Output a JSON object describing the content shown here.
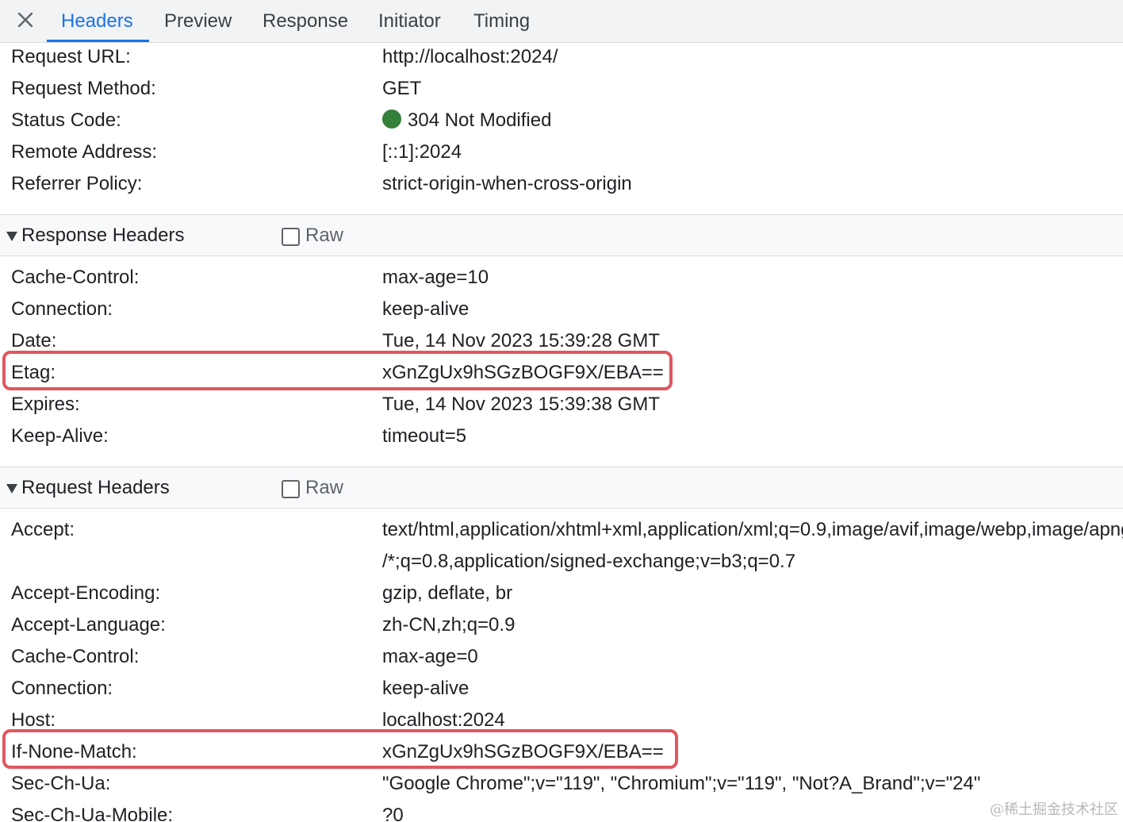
{
  "tabs": [
    {
      "label": "Headers",
      "active": true
    },
    {
      "label": "Preview"
    },
    {
      "label": "Response"
    },
    {
      "label": "Initiator"
    },
    {
      "label": "Timing"
    }
  ],
  "general": [
    {
      "key": "Request URL:",
      "value": "http://localhost:2024/"
    },
    {
      "key": "Request Method:",
      "value": "GET"
    },
    {
      "key": "Status Code:",
      "value": "304 Not Modified"
    },
    {
      "key": "Remote Address:",
      "value": "[::1]:2024"
    },
    {
      "key": "Referrer Policy:",
      "value": "strict-origin-when-cross-origin"
    }
  ],
  "response_headers": {
    "title": "Response Headers",
    "raw_label": "Raw",
    "rows": [
      {
        "key": "Cache-Control:",
        "value": "max-age=10"
      },
      {
        "key": "Connection:",
        "value": "keep-alive"
      },
      {
        "key": "Date:",
        "value": "Tue, 14 Nov 2023 15:39:28 GMT"
      },
      {
        "key": "Etag:",
        "value": "xGnZgUx9hSGzBOGF9X/EBA=="
      },
      {
        "key": "Expires:",
        "value": "Tue, 14 Nov 2023 15:39:38 GMT"
      },
      {
        "key": "Keep-Alive:",
        "value": "timeout=5"
      }
    ]
  },
  "request_headers": {
    "title": "Request Headers",
    "raw_label": "Raw",
    "rows": [
      {
        "key": "Accept:",
        "value": "text/html,application/xhtml+xml,application/xml;q=0.9,image/avif,image/webp,image/apng,*",
        "value_cont": "/*;q=0.8,application/signed-exchange;v=b3;q=0.7"
      },
      {
        "key": "Accept-Encoding:",
        "value": "gzip, deflate, br"
      },
      {
        "key": "Accept-Language:",
        "value": "zh-CN,zh;q=0.9"
      },
      {
        "key": "Cache-Control:",
        "value": "max-age=0"
      },
      {
        "key": "Connection:",
        "value": "keep-alive"
      },
      {
        "key": "Host:",
        "value": "localhost:2024"
      },
      {
        "key": "If-None-Match:",
        "value": "xGnZgUx9hSGzBOGF9X/EBA=="
      },
      {
        "key": "Sec-Ch-Ua:",
        "value": "\"Google Chrome\";v=\"119\", \"Chromium\";v=\"119\", \"Not?A_Brand\";v=\"24\""
      },
      {
        "key": "Sec-Ch-Ua-Mobile:",
        "value": "?0"
      }
    ]
  },
  "colors": {
    "accent": "#1a73e8",
    "status_ok": "#34803a",
    "highlight": "#e0575f"
  },
  "watermark": "@稀土掘金技术社区"
}
